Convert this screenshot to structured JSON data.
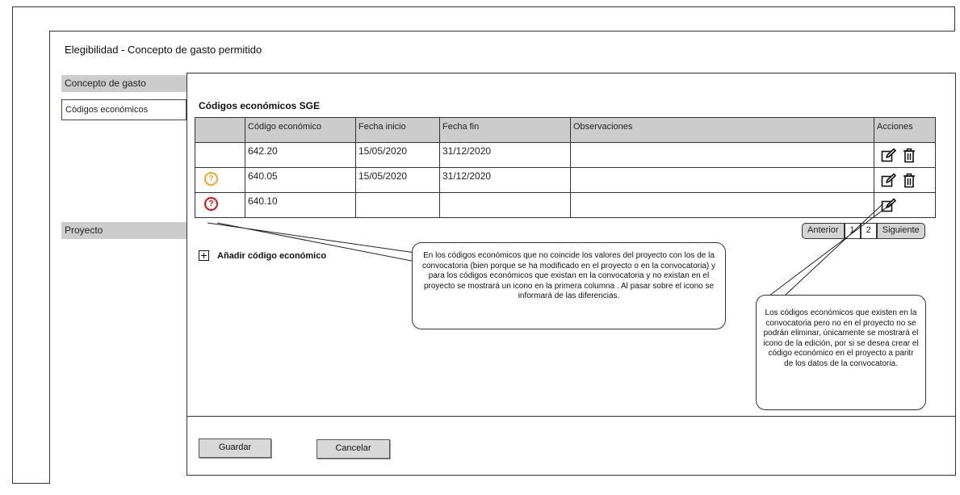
{
  "page": {
    "title": "Elegibilidad - Concepto de gasto permitido"
  },
  "sidebar": {
    "items": [
      {
        "label": "Concepto de gasto"
      },
      {
        "label": "Códigos económicos"
      },
      {
        "label": "Proyecto"
      }
    ]
  },
  "section": {
    "title": "Códigos económicos SGE"
  },
  "table": {
    "columns": [
      "",
      "Código económico",
      "Fecha inicio",
      "Fecha fin",
      "Observaciones",
      "Acciones"
    ],
    "rows": [
      {
        "status": "",
        "code": "642.20",
        "start": "15/05/2020",
        "end": "31/12/2020",
        "notes": ""
      },
      {
        "status": "orange",
        "code": "640.05",
        "start": "15/05/2020",
        "end": "31/12/2020",
        "notes": ""
      },
      {
        "status": "red",
        "code": "640.10",
        "start": "",
        "end": "",
        "notes": ""
      }
    ],
    "status_glyph": "?"
  },
  "pager": {
    "prev": "Anterior",
    "page1": "1",
    "page2": "2",
    "next": "Siguiente"
  },
  "add": {
    "label": "Añadir código económico"
  },
  "notes": {
    "note1": "En los códigos económicos que no coincide los valores del proyecto con los de la convocatoria (bien porque se ha modificado en el proyecto o en la convocatoria) y para los códigos económicos que existan en la convocatoria y no existan en el proyecto se mostrará un icono en la primera columna . Al pasar sobre el icono se informará de las diferencias.",
    "note2": "Los códigos económicos que existen en la convocatoria pero no en el proyecto no se podrán eliminar, únicamente se mostrará el icono de la edición, por si se desea crear el código económico en el proyecto a paritr de los datos de la convocatoria."
  },
  "footer": {
    "save": "Guardar",
    "cancel": "Cancelar"
  },
  "colors": {
    "warning": "#f5a623",
    "error": "#e01010",
    "header_grey": "#cccccc"
  }
}
